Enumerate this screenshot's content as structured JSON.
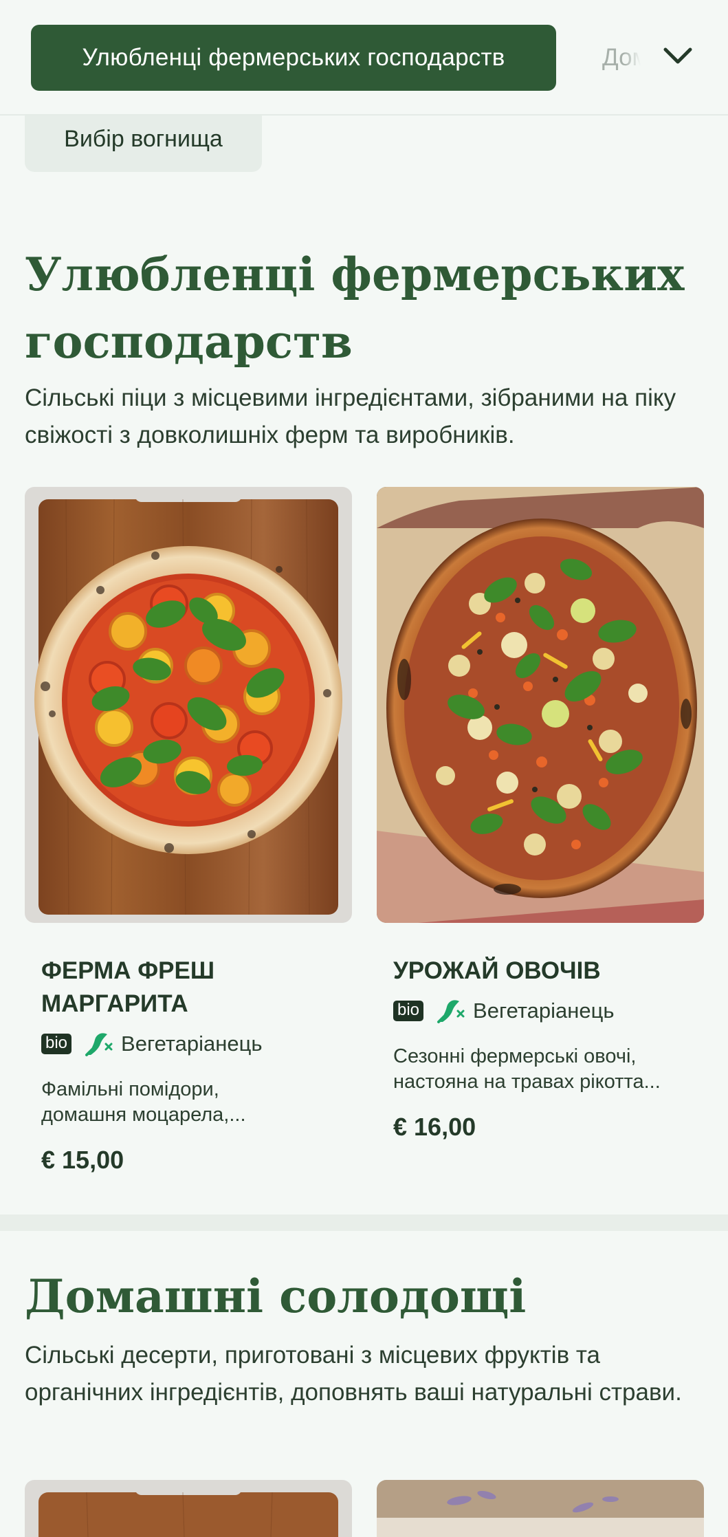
{
  "category_nav": {
    "active_label": "Улюбленці фермерських господарств",
    "next_label_partial": "Домашні солодощі",
    "expand_icon": "chevron-down-icon",
    "previous_label": "Вибір вогнища"
  },
  "sections": [
    {
      "title": "Улюбленці фермерських господарств",
      "description": "Сільські піци з місцевими інгредієнтами, зібраними на піку свіжості з довколишніх ферм та виробників.",
      "items": [
        {
          "name": "Ферма фреш маргарита",
          "badge": "bio",
          "diet_icon": "vegetarian-icon",
          "diet_label": "Вегетаріанець",
          "description_line1": "Фамільні помідори,",
          "description_line2": "домашня моцарела,...",
          "price": "€ 15,00"
        },
        {
          "name": "Урожай овочів",
          "badge": "bio",
          "diet_icon": "vegetarian-icon",
          "diet_label": "Вегетаріанець",
          "description_line1": "Сезонні фермерські овочі,",
          "description_line2": "настояна на травах рікотта...",
          "price": "€ 16,00"
        }
      ]
    },
    {
      "title": "Домашні солодощі",
      "description": "Сільські десерти, приготовані з місцевих фруктів та органічних інгредієнтів, доповнять ваші натуральні страви."
    }
  ],
  "colors": {
    "brand_green": "#2f5a36",
    "background": "#f4f8f5",
    "veg_icon": "#1ea86a"
  }
}
